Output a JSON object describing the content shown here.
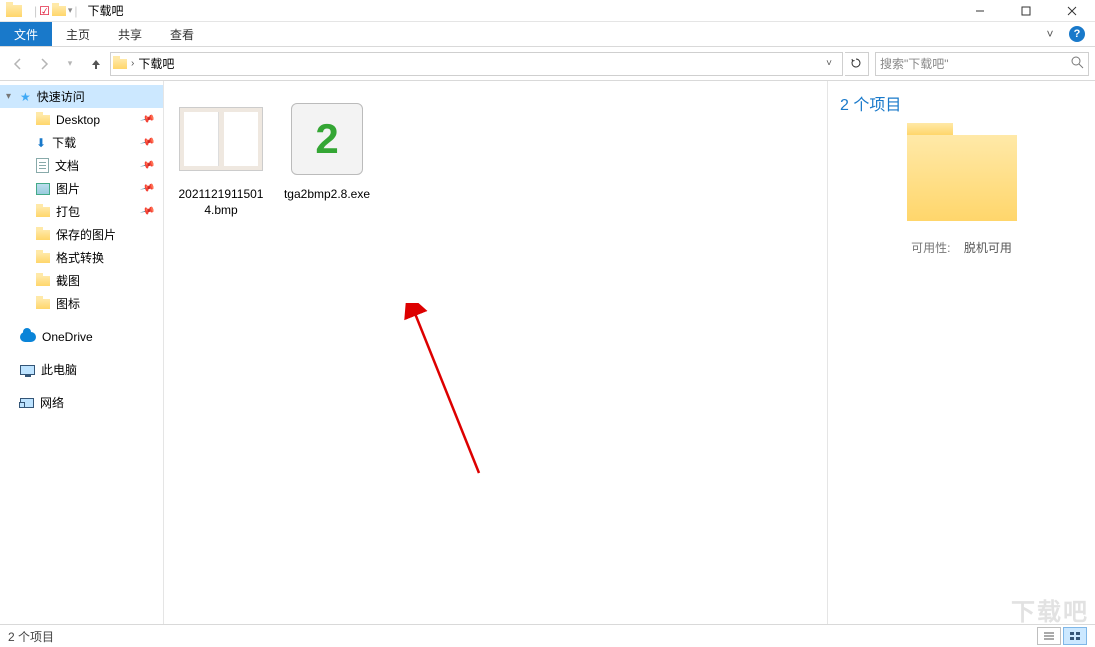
{
  "titlebar": {
    "title": "下载吧"
  },
  "ribbon": {
    "file": "文件",
    "tabs": [
      "主页",
      "共享",
      "查看"
    ]
  },
  "address": {
    "path": "下载吧",
    "search_placeholder": "搜索\"下载吧\""
  },
  "sidebar": {
    "quick_access": "快速访问",
    "items": [
      {
        "label": "Desktop",
        "pinned": true,
        "icon": "folder"
      },
      {
        "label": "下载",
        "pinned": true,
        "icon": "download"
      },
      {
        "label": "文档",
        "pinned": true,
        "icon": "document"
      },
      {
        "label": "图片",
        "pinned": true,
        "icon": "picture"
      },
      {
        "label": "打包",
        "pinned": true,
        "icon": "folder"
      },
      {
        "label": "保存的图片",
        "pinned": false,
        "icon": "folder"
      },
      {
        "label": "格式转换",
        "pinned": false,
        "icon": "folder"
      },
      {
        "label": "截图",
        "pinned": false,
        "icon": "folder"
      },
      {
        "label": "图标",
        "pinned": false,
        "icon": "folder"
      }
    ],
    "onedrive": "OneDrive",
    "this_pc": "此电脑",
    "network": "网络"
  },
  "files": [
    {
      "name": "20211219115014.bmp",
      "type": "bmp"
    },
    {
      "name": "tga2bmp2.8.exe",
      "type": "exe"
    }
  ],
  "details": {
    "title": "2 个项目",
    "availability_label": "可用性:",
    "availability_value": "脱机可用"
  },
  "status": {
    "text": "2 个项目"
  },
  "watermark": "下载吧"
}
